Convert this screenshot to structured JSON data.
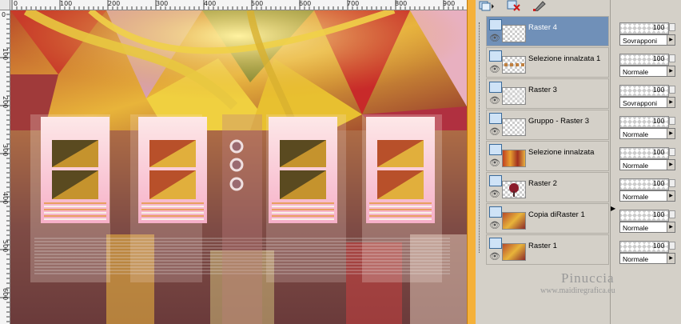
{
  "ruler": {
    "top_ticks": [
      "0",
      "100",
      "200",
      "300",
      "400",
      "500",
      "600",
      "700",
      "800",
      "900"
    ],
    "left_ticks": [
      "0",
      "100",
      "200",
      "300",
      "400",
      "500",
      "600",
      "700"
    ]
  },
  "toolbar": {
    "icons": [
      "new-layer-icon",
      "delete-layer-icon",
      "edit-mask-icon"
    ]
  },
  "layers": [
    {
      "name": "Raster 4",
      "selected": true,
      "opacity": "100",
      "mode": "Sovrapponi",
      "thumb": "transparent"
    },
    {
      "name": "Selezione innalzata 1",
      "selected": false,
      "opacity": "100",
      "mode": "Normale",
      "thumb": "dots"
    },
    {
      "name": "Raster 3",
      "selected": false,
      "opacity": "100",
      "mode": "Sovrapponi",
      "thumb": "frames"
    },
    {
      "name": "Gruppo - Raster 3",
      "selected": false,
      "opacity": "100",
      "mode": "Normale",
      "thumb": "transparent"
    },
    {
      "name": "Selezione innalzata",
      "selected": false,
      "opacity": "100",
      "mode": "Normale",
      "thumb": "strip"
    },
    {
      "name": "Raster 2",
      "selected": false,
      "opacity": "100",
      "mode": "Normale",
      "thumb": "flower"
    },
    {
      "name": "Copia diRaster 1",
      "selected": false,
      "opacity": "100",
      "mode": "Normale",
      "thumb": "image"
    },
    {
      "name": "Raster 1",
      "selected": false,
      "opacity": "100",
      "mode": "Normale",
      "thumb": "image"
    }
  ],
  "watermark": {
    "name": "Pinuccia",
    "url": "www.maidiregrafica.eu"
  },
  "colors": {
    "selected_row": "#7090b8",
    "panel_bg": "#d4d0c8",
    "scrollbar": "#f5b13a"
  }
}
